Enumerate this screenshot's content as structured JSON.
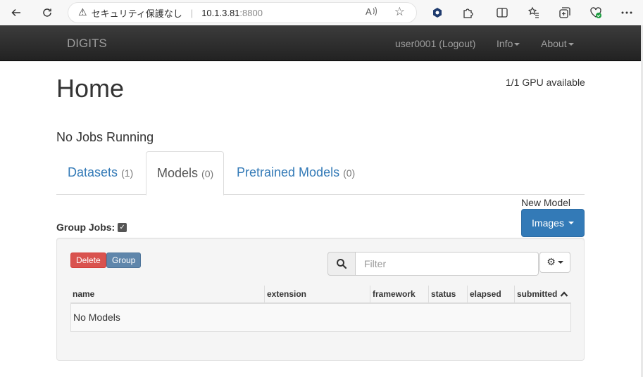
{
  "browser": {
    "insecure_label": "セキュリティ保護なし",
    "separator": "|",
    "host": "10.1.3.81",
    "port": ":8800"
  },
  "navbar": {
    "brand": "DIGITS",
    "user": "user0001 (Logout)",
    "info": "Info",
    "about": "About"
  },
  "header": {
    "title": "Home",
    "gpu_status": "1/1 GPU available"
  },
  "jobs_running": "No Jobs Running",
  "tabs": [
    {
      "label": "Datasets",
      "count": "(1)"
    },
    {
      "label": "Models",
      "count": "(0)"
    },
    {
      "label": "Pretrained Models",
      "count": "(0)"
    }
  ],
  "group_jobs": {
    "label": "Group Jobs:",
    "checked": true
  },
  "new_model": {
    "label": "New Model",
    "button": "Images"
  },
  "toolbar": {
    "delete": "Delete",
    "group": "Group",
    "filter_placeholder": "Filter"
  },
  "table": {
    "columns": [
      "name",
      "extension",
      "framework",
      "status",
      "elapsed",
      "submitted"
    ],
    "sort_indicator": "^",
    "empty": "No Models"
  }
}
